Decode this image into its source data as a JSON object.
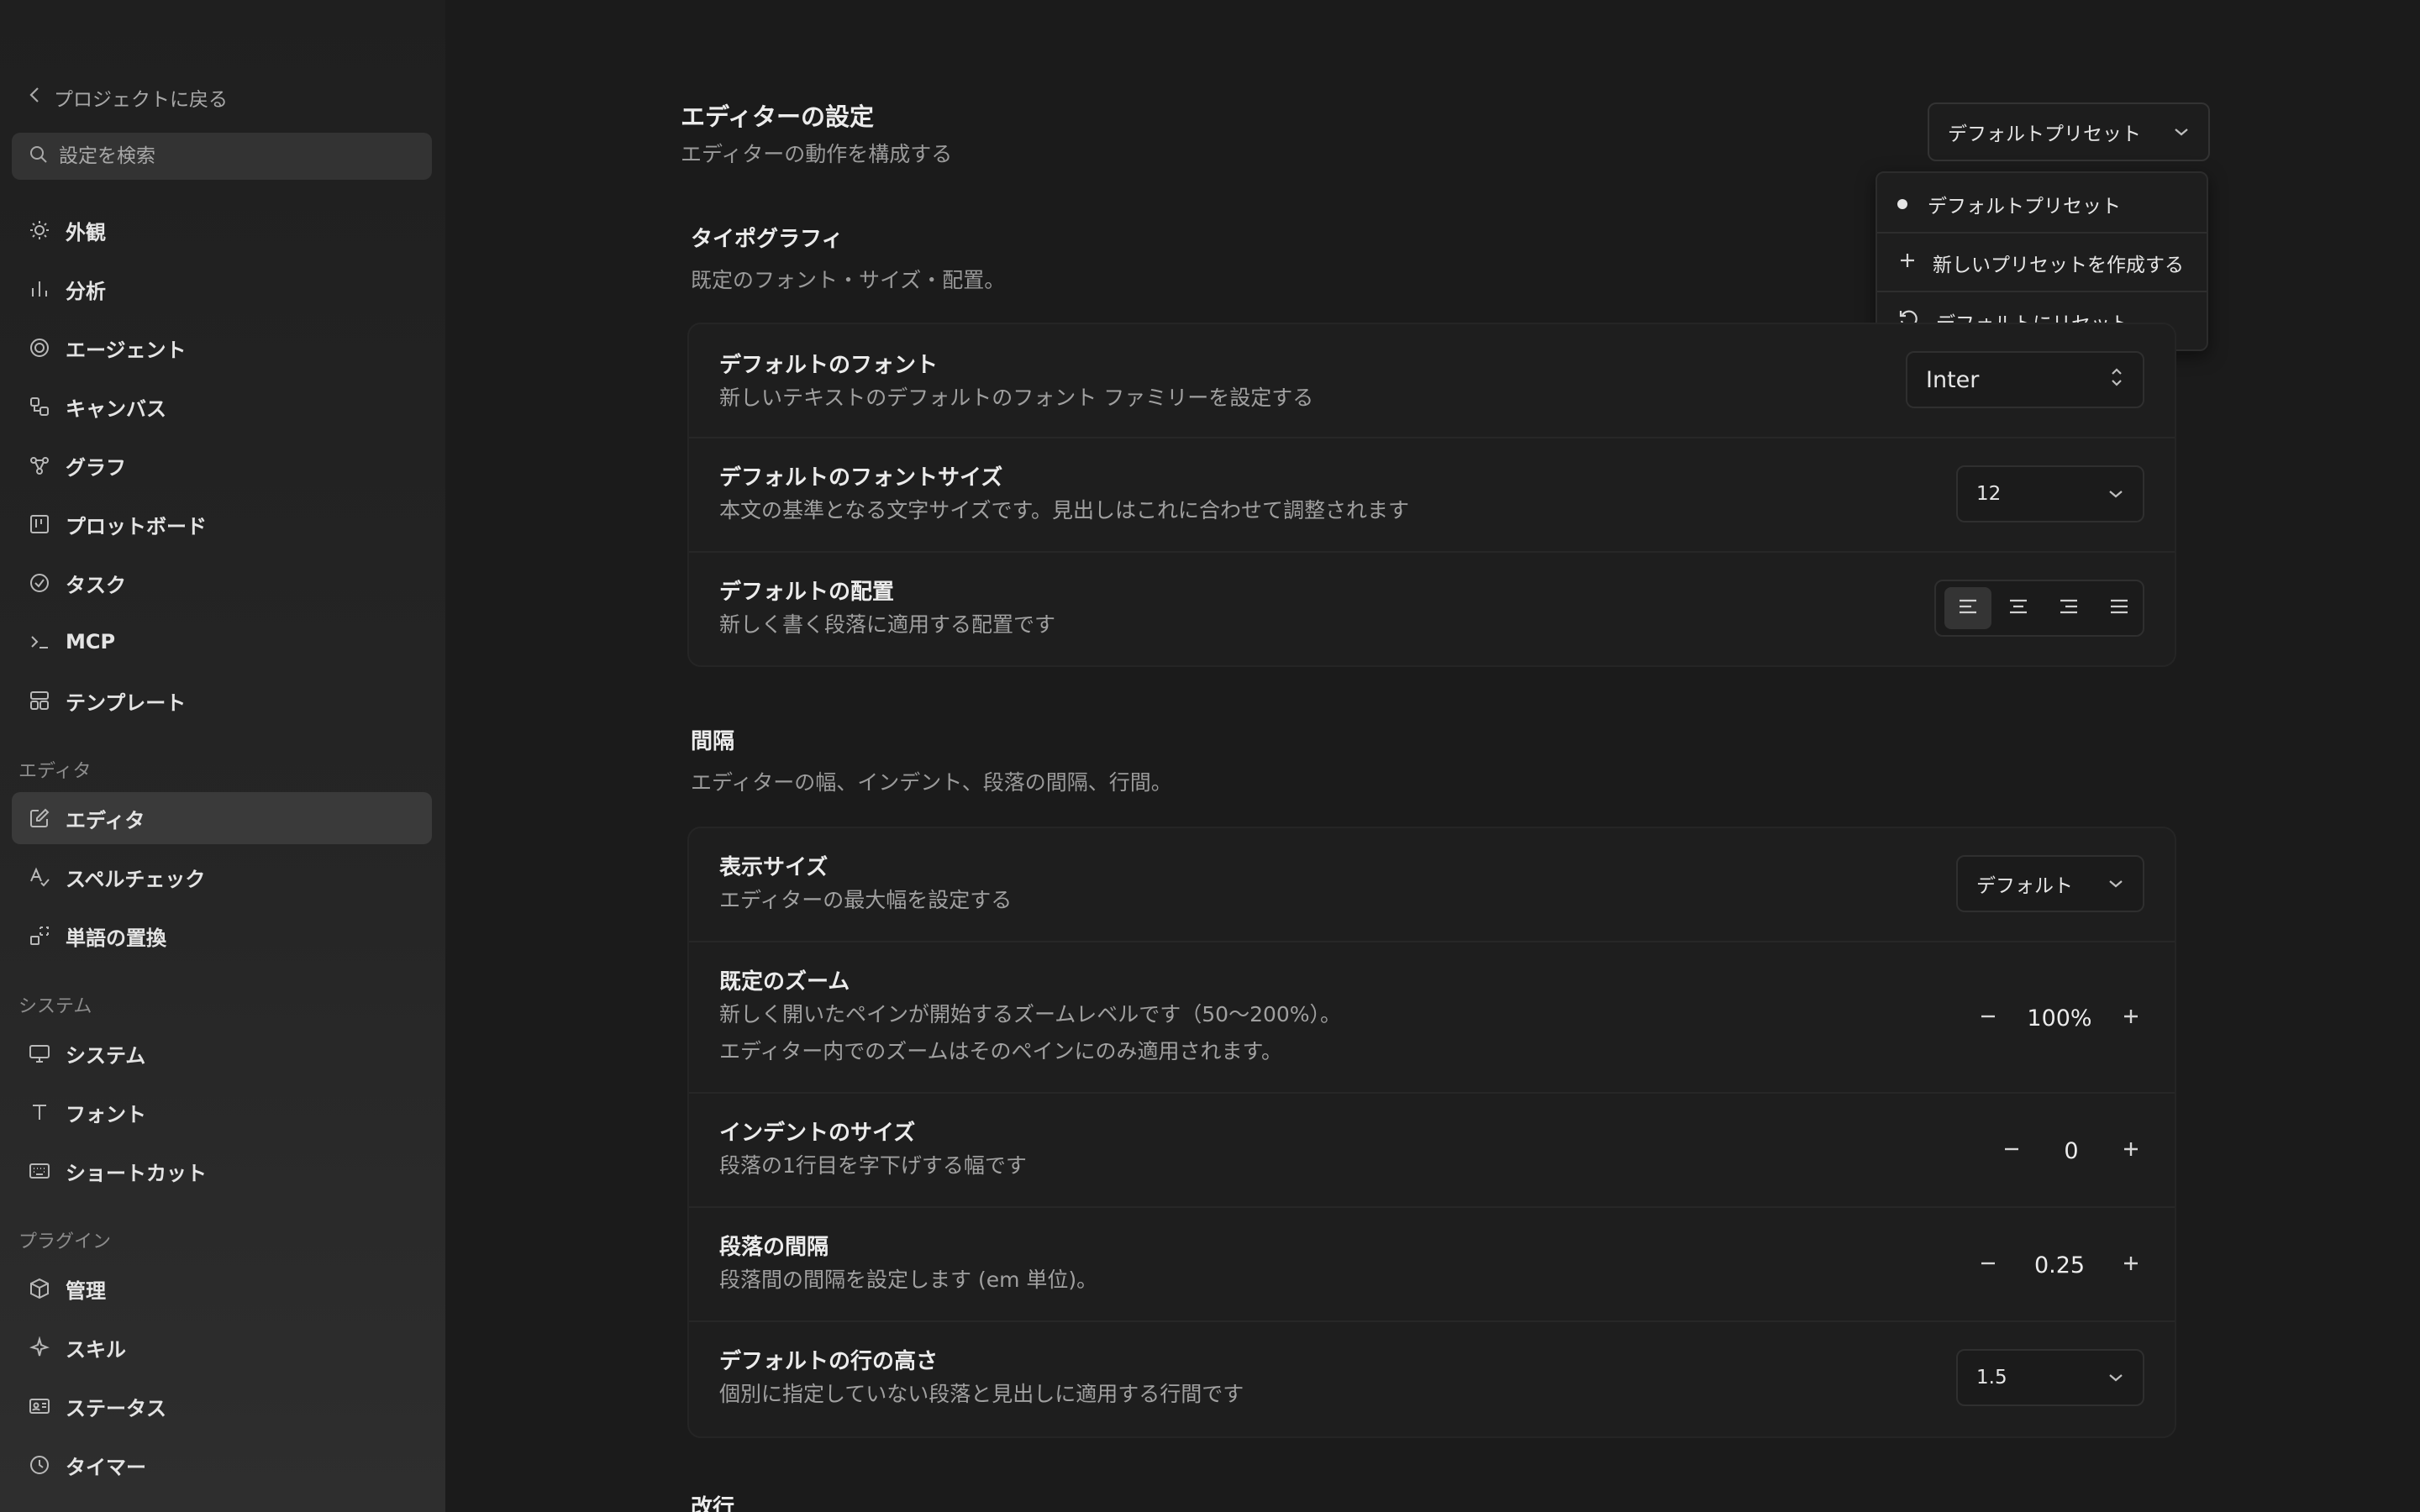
{
  "sidebar": {
    "back_label": "プロジェクトに戻る",
    "search_placeholder": "設定を検索",
    "items_top": [
      {
        "label": "外観",
        "icon": "sun-icon"
      },
      {
        "label": "分析",
        "icon": "bar-chart-icon"
      },
      {
        "label": "エージェント",
        "icon": "swirl-icon"
      },
      {
        "label": "キャンバス",
        "icon": "canvas-icon"
      },
      {
        "label": "グラフ",
        "icon": "graph-icon"
      },
      {
        "label": "プロットボード",
        "icon": "board-icon"
      },
      {
        "label": "タスク",
        "icon": "check-circle-icon"
      },
      {
        "label": "MCP",
        "icon": "terminal-icon"
      },
      {
        "label": "テンプレート",
        "icon": "template-icon"
      }
    ],
    "section_editor": "エディタ",
    "items_editor": [
      {
        "label": "エディタ",
        "icon": "edit-icon"
      },
      {
        "label": "スペルチェック",
        "icon": "spellcheck-icon"
      },
      {
        "label": "単語の置換",
        "icon": "replace-icon"
      }
    ],
    "section_system": "システム",
    "items_system": [
      {
        "label": "システム",
        "icon": "monitor-icon"
      },
      {
        "label": "フォント",
        "icon": "type-icon"
      },
      {
        "label": "ショートカット",
        "icon": "keyboard-icon"
      }
    ],
    "section_plugins": "プラグイン",
    "items_plugins": [
      {
        "label": "管理",
        "icon": "package-icon"
      },
      {
        "label": "スキル",
        "icon": "sparkle-icon"
      },
      {
        "label": "ステータス",
        "icon": "id-card-icon"
      },
      {
        "label": "タイマー",
        "icon": "clock-icon"
      }
    ]
  },
  "header": {
    "title": "エディターの設定",
    "subtitle": "エディターの動作を構成する",
    "preset_selected": "デフォルトプリセット"
  },
  "preset_menu": {
    "items": [
      {
        "label": "デフォルトプリセット",
        "icon": "bullet-icon"
      },
      {
        "label": "新しいプリセットを作成する",
        "icon": "plus-icon"
      },
      {
        "label": "デフォルトにリセット",
        "icon": "reset-icon"
      }
    ]
  },
  "typography": {
    "title": "タイポグラフィ",
    "subtitle": "既定のフォント・サイズ・配置。",
    "font": {
      "label": "デフォルトのフォント",
      "desc": "新しいテキストのデフォルトのフォント ファミリーを設定する",
      "value": "Inter"
    },
    "font_size": {
      "label": "デフォルトのフォントサイズ",
      "desc": "本文の基準となる文字サイズです。見出しはこれに合わせて調整されます",
      "value": "12"
    },
    "align": {
      "label": "デフォルトの配置",
      "desc": "新しく書く段落に適用する配置です",
      "selected": "left"
    }
  },
  "spacing": {
    "title": "間隔",
    "subtitle": "エディターの幅、インデント、段落の間隔、行間。",
    "display_size": {
      "label": "表示サイズ",
      "desc": "エディターの最大幅を設定する",
      "value": "デフォルト"
    },
    "zoom": {
      "label": "既定のズーム",
      "desc1": "新しく開いたペインが開始するズームレベルです（50〜200%）。",
      "desc2": "エディター内でのズームはそのペインにのみ適用されます。",
      "value": "100%"
    },
    "indent": {
      "label": "インデントのサイズ",
      "desc": "段落の1行目を字下げする幅です",
      "value": "0"
    },
    "paragraph": {
      "label": "段落の間隔",
      "desc": "段落間の間隔を設定します (em 単位)。",
      "value": "0.25"
    },
    "line_height": {
      "label": "デフォルトの行の高さ",
      "desc": "個別に指定していない段落と見出しに適用する行間です",
      "value": "1.5"
    }
  },
  "next_section": {
    "title": "改行"
  }
}
